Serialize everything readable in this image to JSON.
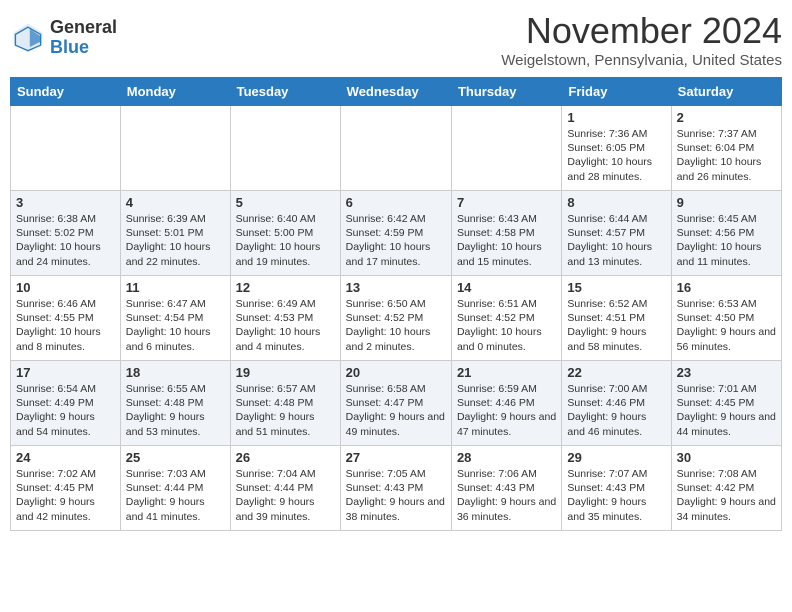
{
  "header": {
    "logo_general": "General",
    "logo_blue": "Blue",
    "month": "November 2024",
    "location": "Weigelstown, Pennsylvania, United States"
  },
  "weekdays": [
    "Sunday",
    "Monday",
    "Tuesday",
    "Wednesday",
    "Thursday",
    "Friday",
    "Saturday"
  ],
  "weeks": [
    [
      {
        "day": "",
        "info": ""
      },
      {
        "day": "",
        "info": ""
      },
      {
        "day": "",
        "info": ""
      },
      {
        "day": "",
        "info": ""
      },
      {
        "day": "",
        "info": ""
      },
      {
        "day": "1",
        "info": "Sunrise: 7:36 AM\nSunset: 6:05 PM\nDaylight: 10 hours and 28 minutes."
      },
      {
        "day": "2",
        "info": "Sunrise: 7:37 AM\nSunset: 6:04 PM\nDaylight: 10 hours and 26 minutes."
      }
    ],
    [
      {
        "day": "3",
        "info": "Sunrise: 6:38 AM\nSunset: 5:02 PM\nDaylight: 10 hours and 24 minutes."
      },
      {
        "day": "4",
        "info": "Sunrise: 6:39 AM\nSunset: 5:01 PM\nDaylight: 10 hours and 22 minutes."
      },
      {
        "day": "5",
        "info": "Sunrise: 6:40 AM\nSunset: 5:00 PM\nDaylight: 10 hours and 19 minutes."
      },
      {
        "day": "6",
        "info": "Sunrise: 6:42 AM\nSunset: 4:59 PM\nDaylight: 10 hours and 17 minutes."
      },
      {
        "day": "7",
        "info": "Sunrise: 6:43 AM\nSunset: 4:58 PM\nDaylight: 10 hours and 15 minutes."
      },
      {
        "day": "8",
        "info": "Sunrise: 6:44 AM\nSunset: 4:57 PM\nDaylight: 10 hours and 13 minutes."
      },
      {
        "day": "9",
        "info": "Sunrise: 6:45 AM\nSunset: 4:56 PM\nDaylight: 10 hours and 11 minutes."
      }
    ],
    [
      {
        "day": "10",
        "info": "Sunrise: 6:46 AM\nSunset: 4:55 PM\nDaylight: 10 hours and 8 minutes."
      },
      {
        "day": "11",
        "info": "Sunrise: 6:47 AM\nSunset: 4:54 PM\nDaylight: 10 hours and 6 minutes."
      },
      {
        "day": "12",
        "info": "Sunrise: 6:49 AM\nSunset: 4:53 PM\nDaylight: 10 hours and 4 minutes."
      },
      {
        "day": "13",
        "info": "Sunrise: 6:50 AM\nSunset: 4:52 PM\nDaylight: 10 hours and 2 minutes."
      },
      {
        "day": "14",
        "info": "Sunrise: 6:51 AM\nSunset: 4:52 PM\nDaylight: 10 hours and 0 minutes."
      },
      {
        "day": "15",
        "info": "Sunrise: 6:52 AM\nSunset: 4:51 PM\nDaylight: 9 hours and 58 minutes."
      },
      {
        "day": "16",
        "info": "Sunrise: 6:53 AM\nSunset: 4:50 PM\nDaylight: 9 hours and 56 minutes."
      }
    ],
    [
      {
        "day": "17",
        "info": "Sunrise: 6:54 AM\nSunset: 4:49 PM\nDaylight: 9 hours and 54 minutes."
      },
      {
        "day": "18",
        "info": "Sunrise: 6:55 AM\nSunset: 4:48 PM\nDaylight: 9 hours and 53 minutes."
      },
      {
        "day": "19",
        "info": "Sunrise: 6:57 AM\nSunset: 4:48 PM\nDaylight: 9 hours and 51 minutes."
      },
      {
        "day": "20",
        "info": "Sunrise: 6:58 AM\nSunset: 4:47 PM\nDaylight: 9 hours and 49 minutes."
      },
      {
        "day": "21",
        "info": "Sunrise: 6:59 AM\nSunset: 4:46 PM\nDaylight: 9 hours and 47 minutes."
      },
      {
        "day": "22",
        "info": "Sunrise: 7:00 AM\nSunset: 4:46 PM\nDaylight: 9 hours and 46 minutes."
      },
      {
        "day": "23",
        "info": "Sunrise: 7:01 AM\nSunset: 4:45 PM\nDaylight: 9 hours and 44 minutes."
      }
    ],
    [
      {
        "day": "24",
        "info": "Sunrise: 7:02 AM\nSunset: 4:45 PM\nDaylight: 9 hours and 42 minutes."
      },
      {
        "day": "25",
        "info": "Sunrise: 7:03 AM\nSunset: 4:44 PM\nDaylight: 9 hours and 41 minutes."
      },
      {
        "day": "26",
        "info": "Sunrise: 7:04 AM\nSunset: 4:44 PM\nDaylight: 9 hours and 39 minutes."
      },
      {
        "day": "27",
        "info": "Sunrise: 7:05 AM\nSunset: 4:43 PM\nDaylight: 9 hours and 38 minutes."
      },
      {
        "day": "28",
        "info": "Sunrise: 7:06 AM\nSunset: 4:43 PM\nDaylight: 9 hours and 36 minutes."
      },
      {
        "day": "29",
        "info": "Sunrise: 7:07 AM\nSunset: 4:43 PM\nDaylight: 9 hours and 35 minutes."
      },
      {
        "day": "30",
        "info": "Sunrise: 7:08 AM\nSunset: 4:42 PM\nDaylight: 9 hours and 34 minutes."
      }
    ]
  ]
}
